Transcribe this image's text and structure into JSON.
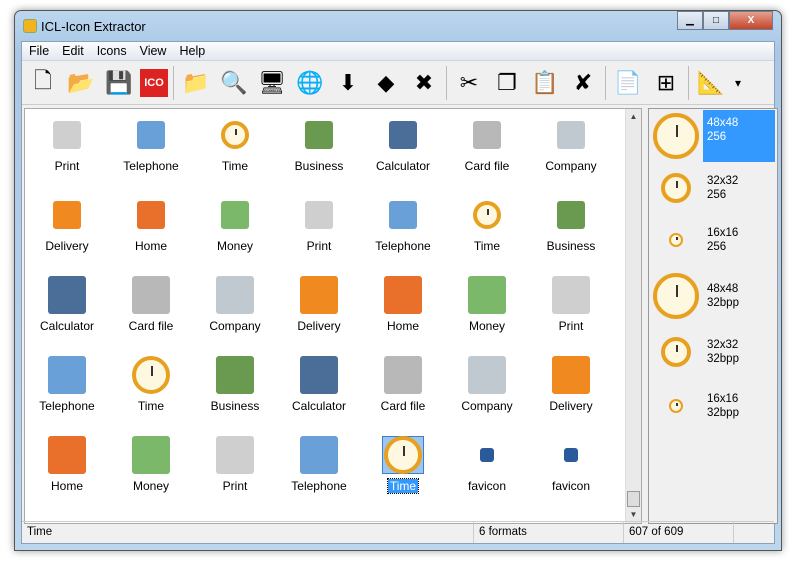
{
  "window": {
    "title": "ICL-Icon Extractor",
    "minimize": "▁",
    "maximize": "□",
    "close": "X"
  },
  "menu": [
    "File",
    "Edit",
    "Icons",
    "View",
    "Help"
  ],
  "toolbar": [
    {
      "name": "new-icon",
      "glyph": "🗋"
    },
    {
      "name": "open-folder-icon",
      "glyph": "📂"
    },
    {
      "name": "save-icon",
      "glyph": "💾"
    },
    {
      "name": "save-ico-icon",
      "glyph": "ICO"
    },
    {
      "sep": true
    },
    {
      "name": "add-folder-icon",
      "glyph": "📁"
    },
    {
      "name": "search-folder-icon",
      "glyph": "🔍"
    },
    {
      "name": "monitor-search-icon",
      "glyph": "🖥"
    },
    {
      "name": "globe-search-icon",
      "glyph": "🌐"
    },
    {
      "name": "extract-image-icon",
      "glyph": "⬇"
    },
    {
      "name": "cubes-icon",
      "glyph": "◆"
    },
    {
      "name": "delete-image-icon",
      "glyph": "✖"
    },
    {
      "sep": true
    },
    {
      "name": "cut-icon",
      "glyph": "✂"
    },
    {
      "name": "copy-icon",
      "glyph": "❐"
    },
    {
      "name": "paste-icon",
      "glyph": "📋"
    },
    {
      "name": "delete-icon",
      "glyph": "✘"
    },
    {
      "sep": true
    },
    {
      "name": "properties-icon",
      "glyph": "📄"
    },
    {
      "name": "windows-icon",
      "glyph": "⊞"
    },
    {
      "sep": true
    },
    {
      "name": "resize-icon",
      "glyph": "📐"
    },
    {
      "name": "dropdown-icon",
      "glyph": "▾"
    }
  ],
  "icons": [
    "Print",
    "Telephone",
    "Time",
    "Business",
    "Calculator",
    "Card file",
    "Company",
    "Delivery",
    "Home",
    "Money",
    "Print",
    "Telephone",
    "Time",
    "Business",
    "Calculator",
    "Card file",
    "Company",
    "Delivery",
    "Home",
    "Money",
    "Print",
    "Telephone",
    "Time",
    "Business",
    "Calculator",
    "Card file",
    "Company",
    "Delivery",
    "Home",
    "Money",
    "Print",
    "Telephone",
    "Time",
    "favicon",
    "favicon"
  ],
  "selected_index": 32,
  "formats": [
    {
      "size": "48x48",
      "depth": "256"
    },
    {
      "size": "32x32",
      "depth": "256"
    },
    {
      "size": "16x16",
      "depth": "256"
    },
    {
      "size": "48x48",
      "depth": "32bpp"
    },
    {
      "size": "32x32",
      "depth": "32bpp"
    },
    {
      "size": "16x16",
      "depth": "32bpp"
    }
  ],
  "status": {
    "name": "Time",
    "formats": "6 formats",
    "position": "607 of 609"
  }
}
